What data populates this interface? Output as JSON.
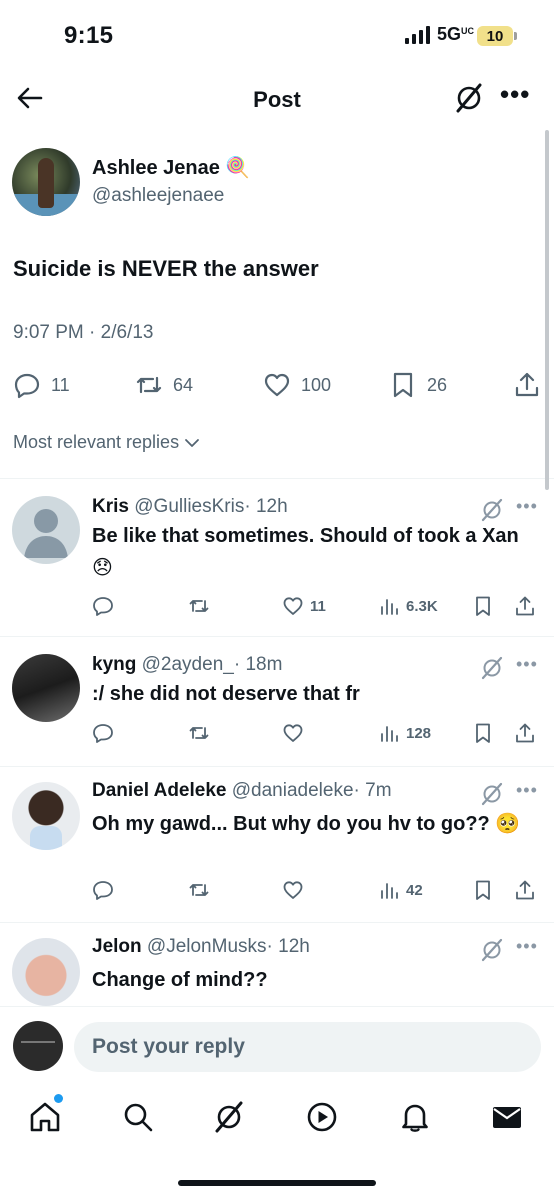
{
  "status_bar": {
    "time": "9:15",
    "network": "5G",
    "network_sup": "UC",
    "battery": "10"
  },
  "header": {
    "title": "Post"
  },
  "post": {
    "author_name": "Ashlee Jenae 🍭",
    "author_handle": "@ashleejenaee",
    "text": "Suicide is NEVER the answer",
    "timestamp": "9:07 PM · 2/6/13",
    "stats": {
      "replies": "11",
      "reposts": "64",
      "likes": "100",
      "bookmarks": "26"
    }
  },
  "sort": {
    "label": "Most relevant replies"
  },
  "replies": [
    {
      "name": "Kris",
      "handle": "@GulliesKris",
      "time": "· 12h",
      "text": "Be like that sometimes. Should of took a Xan 😞",
      "likes": "11",
      "views": "6.3K"
    },
    {
      "name": "kyng",
      "handle": "@2ayden_",
      "time": "· 18m",
      "text": ":/ she did not deserve that fr",
      "likes": "",
      "views": "128"
    },
    {
      "name": "Daniel Adeleke",
      "handle": "@daniadeleke",
      "time": "· 7m",
      "text": "Oh my gawd... But why do you hv to go?? 🥺",
      "likes": "",
      "views": "42"
    },
    {
      "name": "Jelon",
      "handle": "@JelonMusks",
      "time": "· 12h",
      "text": "Change of mind??"
    }
  ],
  "composer": {
    "placeholder": "Post your reply"
  },
  "colors": {
    "accent": "#1d9bf0",
    "muted": "#536471",
    "text": "#0f1419"
  }
}
